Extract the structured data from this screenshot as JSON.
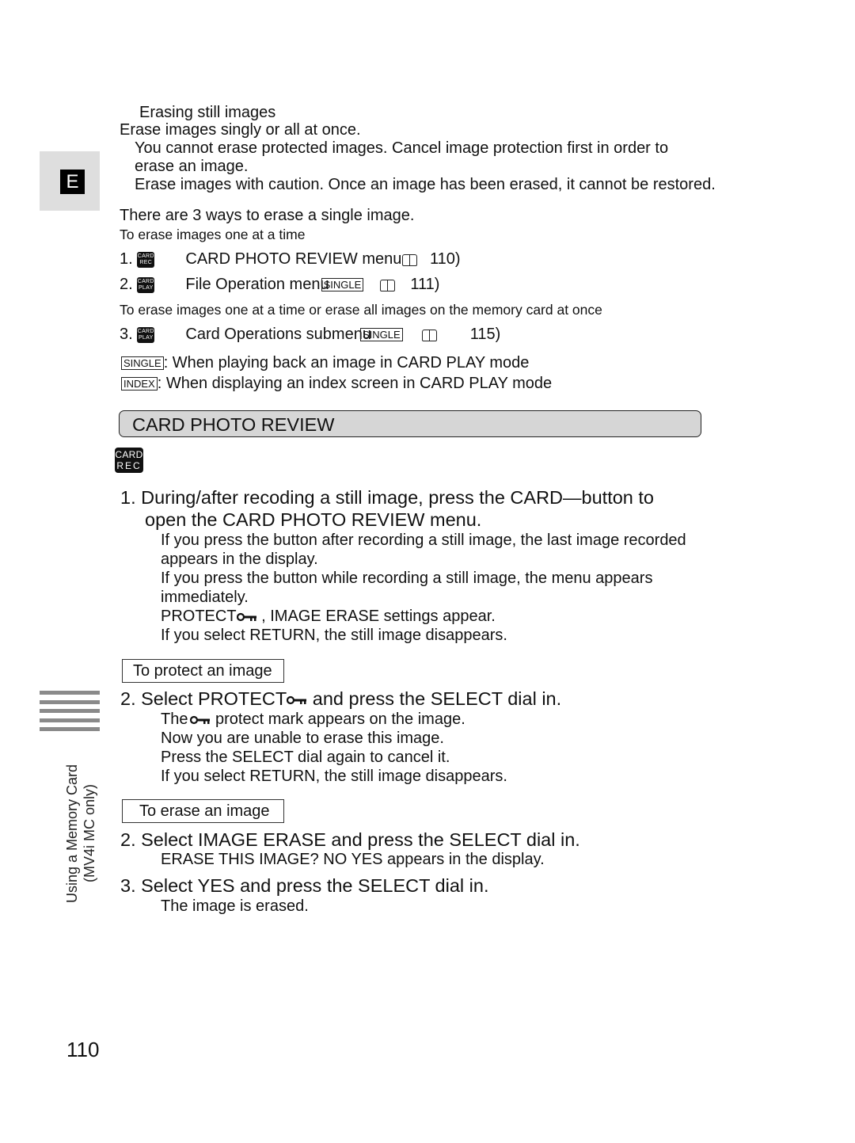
{
  "language_tab": "E",
  "intro": {
    "heading": "Erasing still images",
    "lead": "Erase images singly or all at once.",
    "note1_line1": "You cannot erase protected images. Cancel image protection first in order to",
    "note1_line2": "erase an image.",
    "note2": "Erase images with caution. Once an image has been erased, it cannot be restored."
  },
  "ways": {
    "intro": "There are 3 ways to erase a single image.",
    "group1_title": "To erase images one at a time",
    "items": [
      {
        "num": "1.",
        "badge_top": "CARD",
        "badge_bottom": "REC",
        "text": "CARD PHOTO REVIEW menu",
        "mode": "",
        "page": "110)"
      },
      {
        "num": "2.",
        "badge_top": "CARD",
        "badge_bottom": "PLAY",
        "text": "File Operation menu",
        "mode": "SINGLE",
        "page": "111)"
      },
      {
        "num": "3.",
        "badge_top": "CARD",
        "badge_bottom": "PLAY",
        "text": "Card Operations submenu",
        "mode": "SINGLE",
        "page": "115)"
      }
    ],
    "group2_title": "To erase images one at a time or erase all images on the memory card at once",
    "legend": [
      {
        "label": "SINGLE",
        "text": ": When playing back an image in CARD PLAY mode"
      },
      {
        "label": "INDEX",
        "text": ":  When displaying an index screen in CARD PLAY mode"
      }
    ]
  },
  "section": {
    "title": "CARD PHOTO REVIEW",
    "badge_top": "CARD",
    "badge_bottom": "REC"
  },
  "step1": {
    "line1": "1.  During/after recoding a still image, press the CARD—button to",
    "line2": "open the CARD PHOTO REVIEW menu.",
    "notes": [
      "If you press the button after recording a still image, the last image recorded",
      "appears in the display.",
      "If you press the button while recording a still image, the menu appears",
      "immediately."
    ],
    "protect_prefix": "PROTECT",
    "protect_suffix": " , IMAGE ERASE settings appear.",
    "return_note": "If you select   RETURN, the still image disappears."
  },
  "protect": {
    "subhead": "To protect an image",
    "step_prefix": "2.  Select PROTECT",
    "step_suffix": "  and press the SELECT dial in.",
    "note_prefix": "The",
    "note_suffix": " protect mark appears on the image.",
    "notes": [
      "Now you are unable to erase this image.",
      "Press the SELECT dial again to cancel it.",
      "If you select   RETURN, the still image disappears."
    ]
  },
  "erase": {
    "subhead": "To erase an image",
    "step2": "2.  Select IMAGE ERASE and press the SELECT dial in.",
    "step2_note": "ERASE THIS IMAGE? NO YES appears in the display.",
    "step3": "3.  Select YES and press the SELECT dial in.",
    "step3_note": "The image is erased."
  },
  "sidebar": {
    "line1": "Using a Memory Card",
    "line2": "(MV4i MC only)"
  },
  "page_number": "110"
}
